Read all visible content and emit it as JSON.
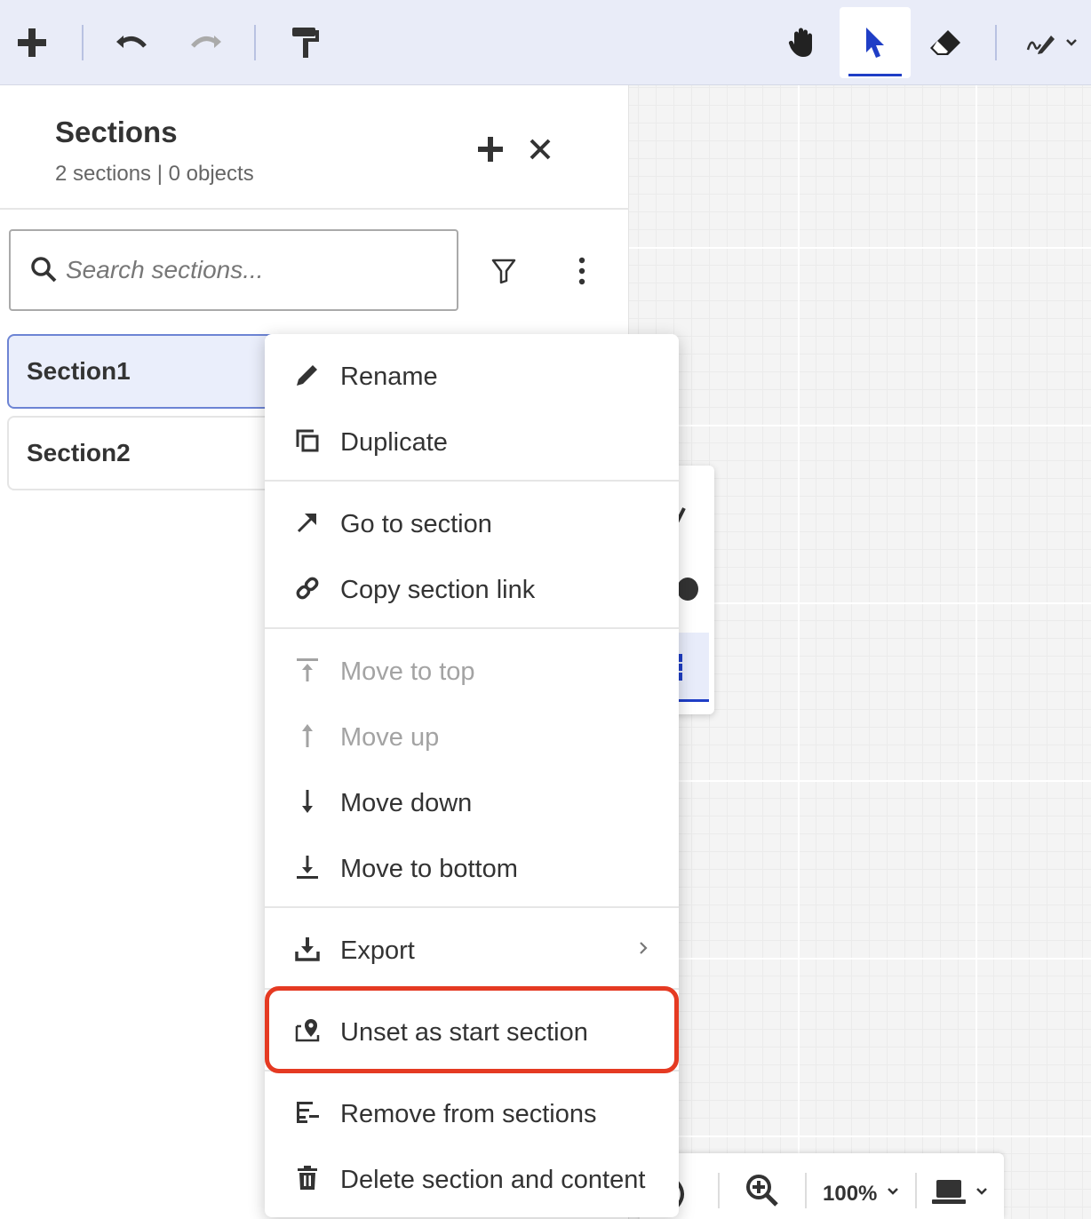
{
  "toolbar": {
    "left_icons": [
      "plus-icon",
      "undo-icon",
      "redo-icon",
      "format-painter-icon"
    ],
    "right_icons": [
      "hand-icon",
      "pointer-icon",
      "eraser-icon",
      "pen-icon"
    ],
    "active_tool": "pointer",
    "accent_color": "#1f3ec6"
  },
  "panel": {
    "title": "Sections",
    "subtitle": "2 sections | 0 objects",
    "search_placeholder": "Search sections...",
    "sections": [
      {
        "label": "Section1",
        "selected": true
      },
      {
        "label": "Section2",
        "selected": false
      }
    ]
  },
  "context_menu": {
    "groups": [
      [
        {
          "label": "Rename",
          "icon": "pencil-icon",
          "enabled": true
        },
        {
          "label": "Duplicate",
          "icon": "duplicate-icon",
          "enabled": true
        }
      ],
      [
        {
          "label": "Go to section",
          "icon": "arrow-up-right-icon",
          "enabled": true
        },
        {
          "label": "Copy section link",
          "icon": "link-icon",
          "enabled": true
        }
      ],
      [
        {
          "label": "Move to top",
          "icon": "move-top-icon",
          "enabled": false
        },
        {
          "label": "Move up",
          "icon": "arrow-up-icon",
          "enabled": false
        },
        {
          "label": "Move down",
          "icon": "arrow-down-icon",
          "enabled": true
        },
        {
          "label": "Move to bottom",
          "icon": "move-bottom-icon",
          "enabled": true
        }
      ],
      [
        {
          "label": "Export",
          "icon": "download-icon",
          "enabled": true,
          "submenu": true
        }
      ],
      [
        {
          "label": "Unset as start section",
          "icon": "start-location-icon",
          "enabled": true,
          "highlighted": true
        }
      ],
      [
        {
          "label": "Remove from sections",
          "icon": "remove-from-sections-icon",
          "enabled": true
        },
        {
          "label": "Delete section and content",
          "icon": "trash-icon",
          "enabled": true
        }
      ]
    ],
    "highlight_color": "#e53a22"
  },
  "zoombar": {
    "zoom": "100%"
  }
}
